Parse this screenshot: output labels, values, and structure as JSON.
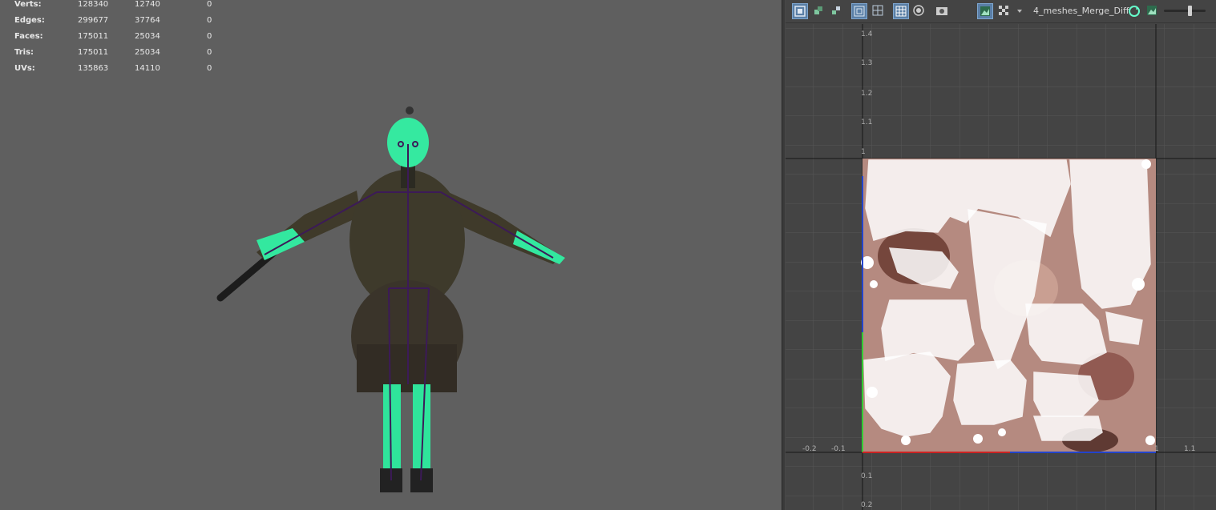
{
  "hud": {
    "rows": [
      {
        "label": "Verts:",
        "c1": "128340",
        "c2": "12740",
        "c3": "0"
      },
      {
        "label": "Edges:",
        "c1": "299677",
        "c2": "37764",
        "c3": "0"
      },
      {
        "label": "Faces:",
        "c1": "175011",
        "c2": "25034",
        "c3": "0"
      },
      {
        "label": "Tris:",
        "c1": "175011",
        "c2": "25034",
        "c3": "0"
      },
      {
        "label": "UVs:",
        "c1": "135863",
        "c2": "14110",
        "c3": "0"
      }
    ]
  },
  "uv_editor": {
    "texture_name": "4_meshes_Merge_Diff",
    "v_ticks": [
      "1.4",
      "1.3",
      "1.2",
      "1.1",
      "1",
      "0.1",
      "0.2"
    ],
    "u_ticks": [
      "-0.2",
      "-0.1",
      "1",
      "1.1"
    ],
    "toolbar_icons": [
      "uv-shell-icon",
      "uv-move-icon",
      "uv-select-icon",
      "grid-toggle-icon",
      "dim-image-icon",
      "checker-grid-icon",
      "shaded-uv-icon",
      "snapshot-icon",
      "image-display-icon",
      "checker-map-icon",
      "dropdown-arrow-icon",
      "refresh-texture-icon",
      "exposure-icon"
    ],
    "colors": {
      "accent": "#5a7fa6",
      "wireframe": "#00ffaa",
      "skeleton": "#3c1a58"
    }
  }
}
